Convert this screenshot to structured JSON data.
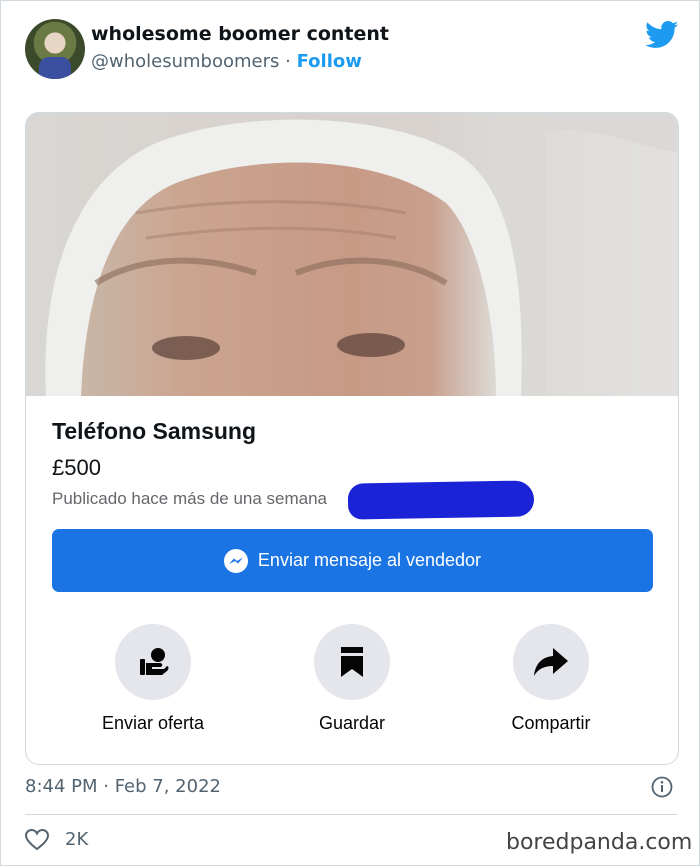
{
  "tweet": {
    "display_name": "wholesome boomer content",
    "handle": "@wholesumboomers",
    "separator": "·",
    "follow_label": "Follow",
    "timestamp": "8:44 PM · Feb 7, 2022",
    "like_count": "2K"
  },
  "listing": {
    "title": "Teléfono Samsung",
    "price": "£500",
    "posted": "Publicado hace más de una semana",
    "message_button": "Enviar mensaje al vendedor",
    "actions": [
      {
        "label": "Enviar oferta",
        "icon": "offer-icon"
      },
      {
        "label": "Guardar",
        "icon": "bookmark-icon"
      },
      {
        "label": "Compartir",
        "icon": "share-icon"
      }
    ]
  },
  "watermark": "boredpanda.com",
  "colors": {
    "twitter_blue": "#1d9bf0",
    "messenger_button": "#1b74e4",
    "redaction": "#1a24d6",
    "muted": "#536471"
  }
}
